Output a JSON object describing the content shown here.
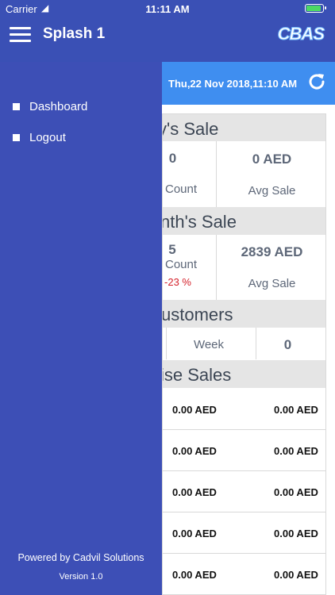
{
  "status_bar": {
    "carrier": "Carrier",
    "time": "11:11 AM"
  },
  "nav": {
    "title": "Splash 1",
    "logo_text": "CBAS"
  },
  "drawer": {
    "items": [
      {
        "label": "Dashboard"
      },
      {
        "label": "Logout"
      }
    ],
    "powered_by": "Powered by Cadvil Solutions",
    "version": "Version 1.0"
  },
  "content": {
    "date": "Thu,22 Nov 2018,11:10 AM",
    "todays_sale": {
      "title": "y's Sale",
      "count_value": "0",
      "count_label": "Count",
      "avg_value": "0 AED",
      "avg_label": "Avg Sale"
    },
    "months_sale": {
      "title": "nth's Sale",
      "count_value": "5",
      "count_label": "Count",
      "change": "-23 %",
      "avg_value": "2839 AED",
      "avg_label": "Avg Sale"
    },
    "customers": {
      "title": "ustomers",
      "week_label": "Week",
      "week_value": "0"
    },
    "wise_sales": {
      "title": "ise Sales",
      "rows": [
        {
          "col1": "0.00 AED",
          "col2": "0.00 AED"
        },
        {
          "col1": "0.00 AED",
          "col2": "0.00 AED"
        },
        {
          "col1": "0.00 AED",
          "col2": "0.00 AED"
        },
        {
          "col1": "0.00 AED",
          "col2": "0.00 AED"
        },
        {
          "col1": "0.00 AED",
          "col2": "0.00 AED"
        }
      ]
    }
  },
  "colors": {
    "nav_blue": "#3a50b5",
    "drawer_blue": "#3d4fb6",
    "date_bar_blue": "#3f8ef0",
    "negative_red": "#d4202a"
  }
}
